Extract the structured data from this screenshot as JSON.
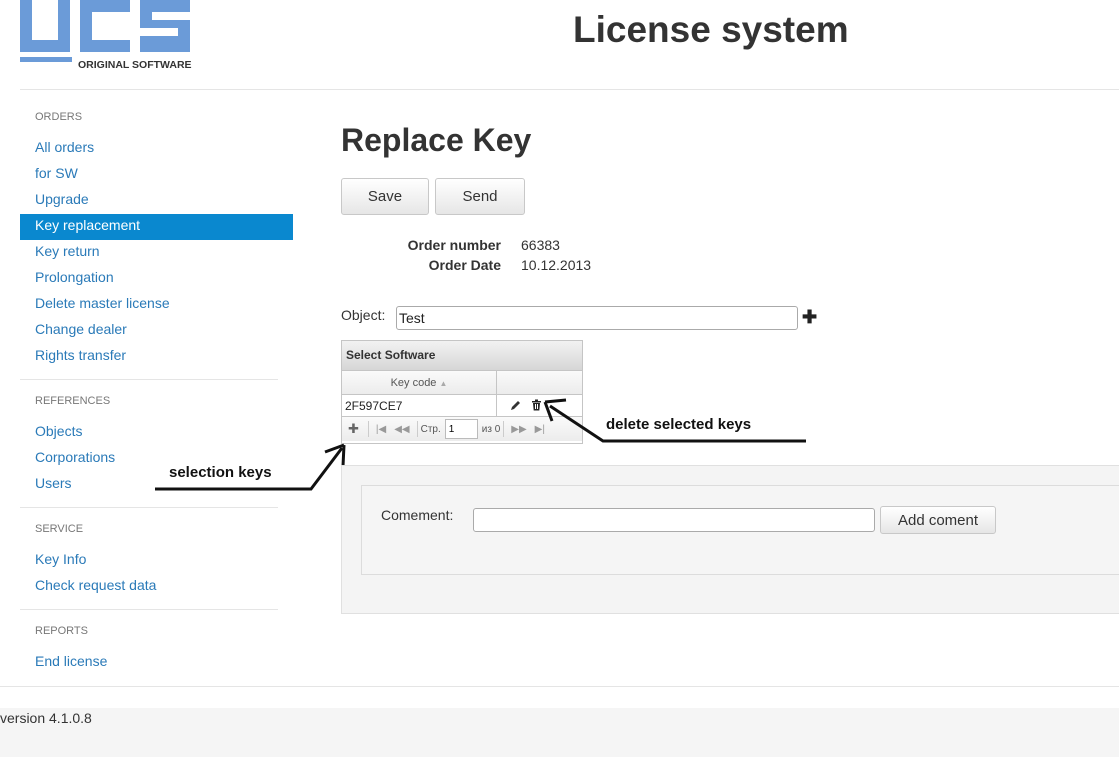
{
  "header": {
    "logo_letters": "UCS",
    "logo_tagline": "ORIGINAL SOFTWARE",
    "app_title": "License system"
  },
  "sidebar": {
    "sections": [
      {
        "title": "ORDERS",
        "items": [
          "All orders",
          "for SW",
          "Upgrade",
          "Key replacement",
          "Key return",
          "Prolongation",
          "Delete master license",
          "Change dealer",
          "Rights transfer"
        ]
      },
      {
        "title": "REFERENCES",
        "items": [
          "Objects",
          "Corporations",
          "Users"
        ]
      },
      {
        "title": "SERVICE",
        "items": [
          "Key Info",
          "Check request data"
        ]
      },
      {
        "title": "REPORTS",
        "items": [
          "End license"
        ]
      }
    ],
    "active_item": "Key replacement"
  },
  "main": {
    "page_title": "Replace Key",
    "save_label": "Save",
    "send_label": "Send",
    "order_number_label": "Order number",
    "order_number": "66383",
    "order_date_label": "Order Date",
    "order_date": "10.12.2013",
    "object_label": "Object:",
    "object_value": "Test",
    "grid": {
      "caption": "Select Software",
      "column_key_code": "Key code",
      "rows": [
        {
          "key_code": "2F597CE7"
        }
      ],
      "pager_page_label": "Стр.",
      "pager_page_value": "1",
      "pager_of_label": "из 0"
    },
    "comment_label": "Comement:",
    "comment_value": "",
    "add_comment_label": "Add coment"
  },
  "annotations": {
    "delete_note": "delete selected keys",
    "selection_note": "selection keys"
  },
  "footer": {
    "version": "version 4.1.0.8"
  },
  "colors": {
    "logo_blue": "#6b9bd8",
    "active_bg": "#0a88cf",
    "link": "#2a7ab8"
  }
}
